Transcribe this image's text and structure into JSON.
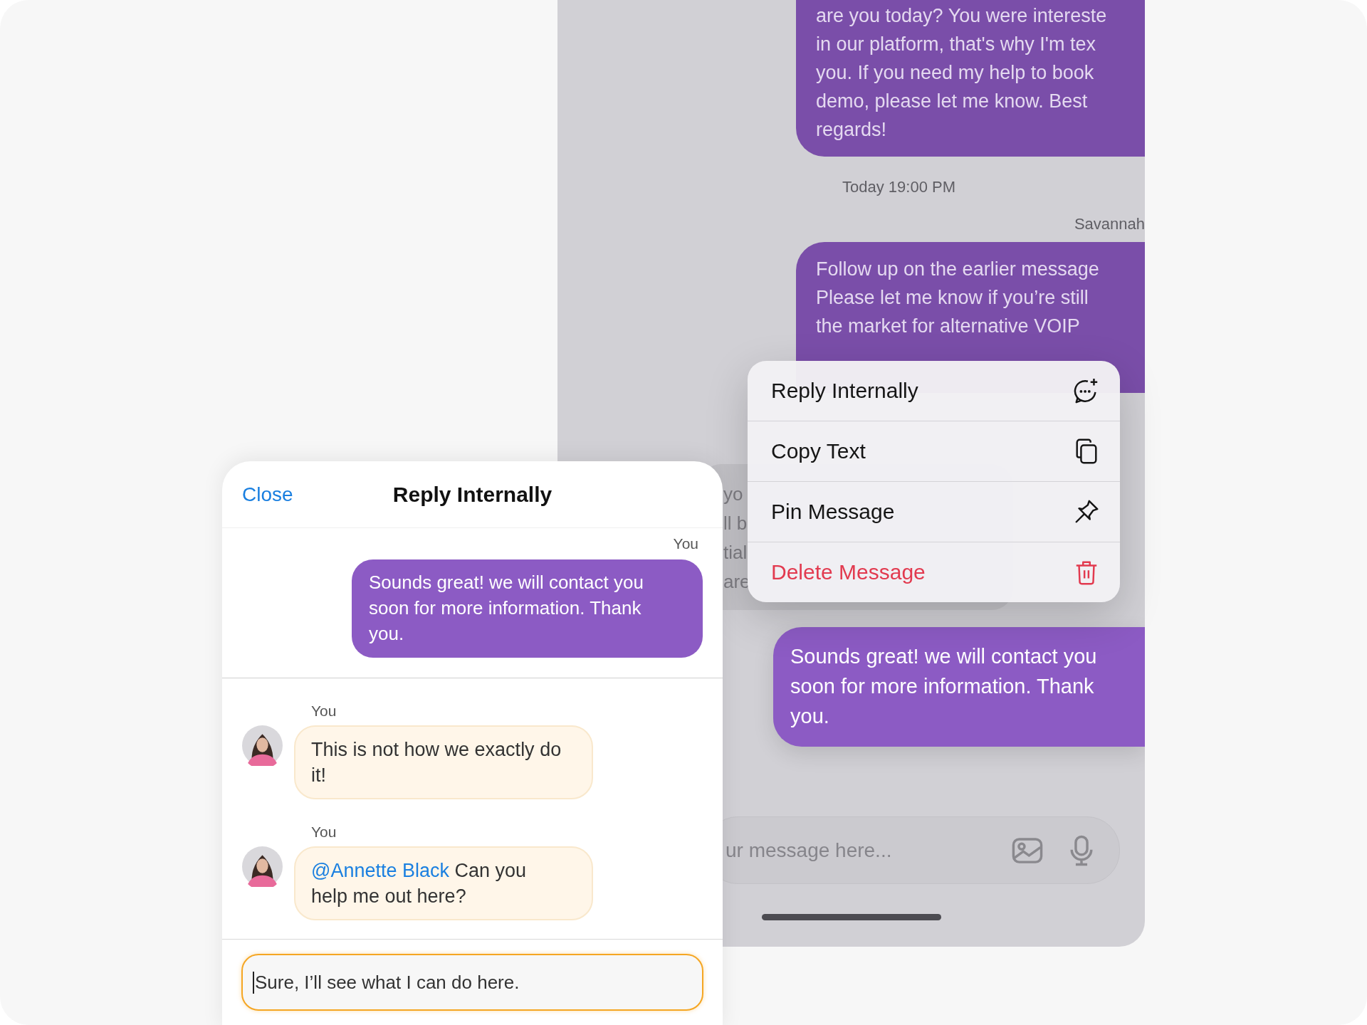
{
  "background_chat": {
    "top_bubble": {
      "lines": [
        "are you today? You were intereste",
        "in our platform, that's why I'm tex",
        "you. If you need my help to book",
        "demo, please let me know. Best",
        "regards!"
      ]
    },
    "timestamp": "Today 19:00 PM",
    "sender": "Savannah",
    "follow_up_bubble": {
      "lines": [
        "Follow up on the earlier message",
        "Please let me know if you’re still",
        "the market for alternative VOIP"
      ]
    },
    "received_bubble": {
      "lines": [
        "yo",
        "ll b",
        "tial",
        "are"
      ]
    },
    "sent_bubble": {
      "text": "Sounds great! we will contact you soon for more information. Thank you."
    },
    "composer": {
      "placeholder": "ur message here..."
    }
  },
  "context_menu": {
    "items": [
      {
        "label": "Reply Internally",
        "kind": "chat-plus",
        "destructive": false
      },
      {
        "label": "Copy Text",
        "kind": "copy",
        "destructive": false
      },
      {
        "label": "Pin Message",
        "kind": "pin",
        "destructive": false
      },
      {
        "label": "Delete Message",
        "kind": "trash",
        "destructive": true
      }
    ]
  },
  "reply_panel": {
    "close": "Close",
    "title": "Reply Internally",
    "quoted": {
      "sender": "You",
      "text": "Sounds great! we will contact you soon for more information. Thank you."
    },
    "comments": [
      {
        "sender": "You",
        "text": "This is not how we exactly do it!"
      },
      {
        "sender": "You",
        "mention": "@Annette Black",
        "text": "Can you help me out here?"
      }
    ],
    "input": {
      "value": "Sure, I’ll see what I can do here.",
      "focused": true
    }
  }
}
